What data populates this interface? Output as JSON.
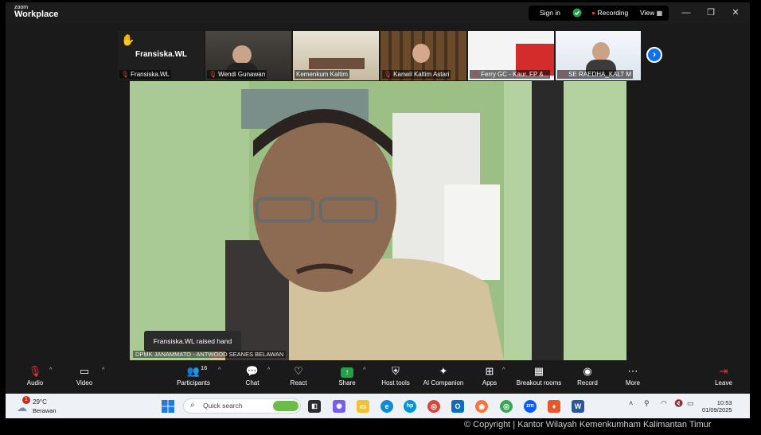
{
  "app": {
    "logo_line1": "zoom",
    "logo_line2": "Workplace"
  },
  "titlebar": {
    "signin": "Sign in",
    "recording": "Recording",
    "view": "View",
    "minimize": "—",
    "restore": "❐",
    "close": "✕"
  },
  "gallery": {
    "raised_hand_name": "Fransiska.WL",
    "thumbnails": [
      {
        "label": "Fransiska.WL"
      },
      {
        "label": "Wendi Gunawan"
      },
      {
        "label": "Kemenkum Kaltim"
      },
      {
        "label": "Kanwil Kaltim Astari"
      },
      {
        "label": "Ferry GC - Kaur. FP &..."
      },
      {
        "label": "SE RAEDHA_KALT M"
      }
    ]
  },
  "main_video": {
    "toast": "Fransiska.WL raised hand",
    "name_label": "DPMK JANAMMATO - ANTWOOD SEANES BELAWAN"
  },
  "controls": {
    "audio": "Audio",
    "video": "Video",
    "participants": "Participants",
    "participants_count": "16",
    "chat": "Chat",
    "react": "React",
    "share": "Share",
    "host_tools": "Host tools",
    "ai_companion": "AI Companion",
    "apps": "Apps",
    "breakout": "Breakout rooms",
    "record": "Record",
    "more": "More",
    "leave": "Leave"
  },
  "taskbar": {
    "weather_temp": "29°C",
    "weather_desc": "Berawan",
    "weather_badge": "1",
    "search_placeholder": "Quick search",
    "time": "10:53",
    "date": "01/09/2025"
  },
  "footer": {
    "copyright": "© Copyright | Kantor Wilayah Kemenkumham Kalimantan Timur"
  },
  "colors": {
    "accent": "#0e72ed",
    "share_green": "#24a148",
    "recording_red": "#e0383e"
  }
}
